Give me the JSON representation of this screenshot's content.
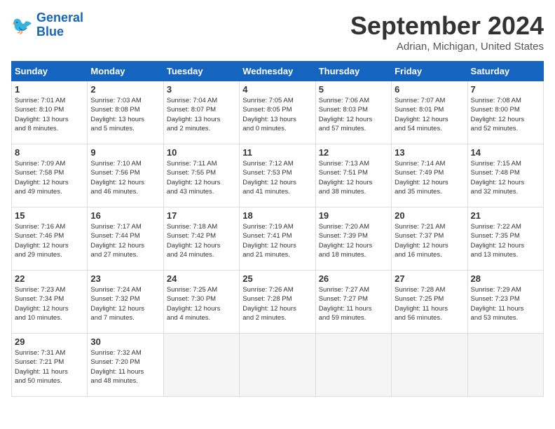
{
  "header": {
    "logo_line1": "General",
    "logo_line2": "Blue",
    "month": "September 2024",
    "location": "Adrian, Michigan, United States"
  },
  "weekdays": [
    "Sunday",
    "Monday",
    "Tuesday",
    "Wednesday",
    "Thursday",
    "Friday",
    "Saturday"
  ],
  "days": [
    {
      "num": "",
      "info": ""
    },
    {
      "num": "",
      "info": ""
    },
    {
      "num": "",
      "info": ""
    },
    {
      "num": "",
      "info": ""
    },
    {
      "num": "",
      "info": ""
    },
    {
      "num": "",
      "info": ""
    },
    {
      "num": "",
      "info": ""
    },
    {
      "num": "1",
      "info": "Sunrise: 7:01 AM\nSunset: 8:10 PM\nDaylight: 13 hours\nand 8 minutes."
    },
    {
      "num": "2",
      "info": "Sunrise: 7:03 AM\nSunset: 8:08 PM\nDaylight: 13 hours\nand 5 minutes."
    },
    {
      "num": "3",
      "info": "Sunrise: 7:04 AM\nSunset: 8:07 PM\nDaylight: 13 hours\nand 2 minutes."
    },
    {
      "num": "4",
      "info": "Sunrise: 7:05 AM\nSunset: 8:05 PM\nDaylight: 13 hours\nand 0 minutes."
    },
    {
      "num": "5",
      "info": "Sunrise: 7:06 AM\nSunset: 8:03 PM\nDaylight: 12 hours\nand 57 minutes."
    },
    {
      "num": "6",
      "info": "Sunrise: 7:07 AM\nSunset: 8:01 PM\nDaylight: 12 hours\nand 54 minutes."
    },
    {
      "num": "7",
      "info": "Sunrise: 7:08 AM\nSunset: 8:00 PM\nDaylight: 12 hours\nand 52 minutes."
    },
    {
      "num": "8",
      "info": "Sunrise: 7:09 AM\nSunset: 7:58 PM\nDaylight: 12 hours\nand 49 minutes."
    },
    {
      "num": "9",
      "info": "Sunrise: 7:10 AM\nSunset: 7:56 PM\nDaylight: 12 hours\nand 46 minutes."
    },
    {
      "num": "10",
      "info": "Sunrise: 7:11 AM\nSunset: 7:55 PM\nDaylight: 12 hours\nand 43 minutes."
    },
    {
      "num": "11",
      "info": "Sunrise: 7:12 AM\nSunset: 7:53 PM\nDaylight: 12 hours\nand 41 minutes."
    },
    {
      "num": "12",
      "info": "Sunrise: 7:13 AM\nSunset: 7:51 PM\nDaylight: 12 hours\nand 38 minutes."
    },
    {
      "num": "13",
      "info": "Sunrise: 7:14 AM\nSunset: 7:49 PM\nDaylight: 12 hours\nand 35 minutes."
    },
    {
      "num": "14",
      "info": "Sunrise: 7:15 AM\nSunset: 7:48 PM\nDaylight: 12 hours\nand 32 minutes."
    },
    {
      "num": "15",
      "info": "Sunrise: 7:16 AM\nSunset: 7:46 PM\nDaylight: 12 hours\nand 29 minutes."
    },
    {
      "num": "16",
      "info": "Sunrise: 7:17 AM\nSunset: 7:44 PM\nDaylight: 12 hours\nand 27 minutes."
    },
    {
      "num": "17",
      "info": "Sunrise: 7:18 AM\nSunset: 7:42 PM\nDaylight: 12 hours\nand 24 minutes."
    },
    {
      "num": "18",
      "info": "Sunrise: 7:19 AM\nSunset: 7:41 PM\nDaylight: 12 hours\nand 21 minutes."
    },
    {
      "num": "19",
      "info": "Sunrise: 7:20 AM\nSunset: 7:39 PM\nDaylight: 12 hours\nand 18 minutes."
    },
    {
      "num": "20",
      "info": "Sunrise: 7:21 AM\nSunset: 7:37 PM\nDaylight: 12 hours\nand 16 minutes."
    },
    {
      "num": "21",
      "info": "Sunrise: 7:22 AM\nSunset: 7:35 PM\nDaylight: 12 hours\nand 13 minutes."
    },
    {
      "num": "22",
      "info": "Sunrise: 7:23 AM\nSunset: 7:34 PM\nDaylight: 12 hours\nand 10 minutes."
    },
    {
      "num": "23",
      "info": "Sunrise: 7:24 AM\nSunset: 7:32 PM\nDaylight: 12 hours\nand 7 minutes."
    },
    {
      "num": "24",
      "info": "Sunrise: 7:25 AM\nSunset: 7:30 PM\nDaylight: 12 hours\nand 4 minutes."
    },
    {
      "num": "25",
      "info": "Sunrise: 7:26 AM\nSunset: 7:28 PM\nDaylight: 12 hours\nand 2 minutes."
    },
    {
      "num": "26",
      "info": "Sunrise: 7:27 AM\nSunset: 7:27 PM\nDaylight: 11 hours\nand 59 minutes."
    },
    {
      "num": "27",
      "info": "Sunrise: 7:28 AM\nSunset: 7:25 PM\nDaylight: 11 hours\nand 56 minutes."
    },
    {
      "num": "28",
      "info": "Sunrise: 7:29 AM\nSunset: 7:23 PM\nDaylight: 11 hours\nand 53 minutes."
    },
    {
      "num": "29",
      "info": "Sunrise: 7:31 AM\nSunset: 7:21 PM\nDaylight: 11 hours\nand 50 minutes."
    },
    {
      "num": "30",
      "info": "Sunrise: 7:32 AM\nSunset: 7:20 PM\nDaylight: 11 hours\nand 48 minutes."
    },
    {
      "num": "",
      "info": ""
    },
    {
      "num": "",
      "info": ""
    },
    {
      "num": "",
      "info": ""
    },
    {
      "num": "",
      "info": ""
    },
    {
      "num": "",
      "info": ""
    }
  ]
}
